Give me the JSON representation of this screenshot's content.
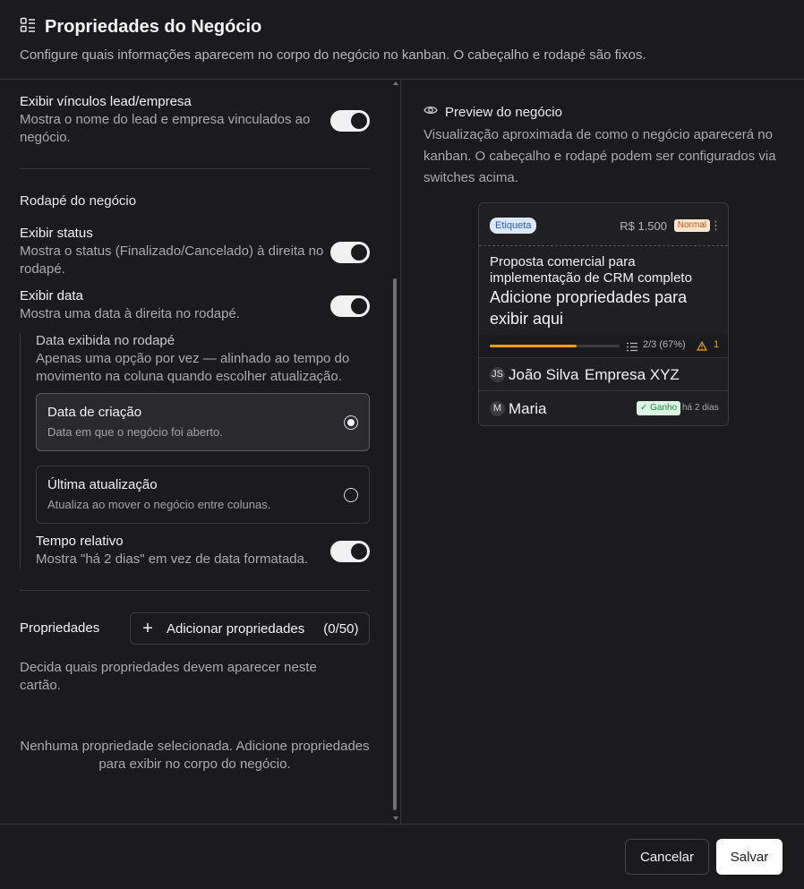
{
  "header": {
    "title": "Propriedades do Negócio",
    "subtitle": "Configure quais informações aparecem no corpo do negócio no kanban. O cabeçalho e rodapé são fixos."
  },
  "settings": {
    "links": {
      "title": "Exibir vínculos lead/empresa",
      "desc": "Mostra o nome do lead e empresa vinculados ao negócio.",
      "enabled": true
    },
    "footer_section_title": "Rodapé do negócio",
    "status": {
      "title": "Exibir status",
      "desc": "Mostra o status (Finalizado/Cancelado) à direita no rodapé.",
      "enabled": true
    },
    "date": {
      "title": "Exibir data",
      "desc": "Mostra uma data à direita no rodapé.",
      "enabled": true
    },
    "date_sub": {
      "title": "Data exibida no rodapé",
      "desc": "Apenas uma opção por vez — alinhado ao tempo do movimento na coluna quando escolher atualização.",
      "options": [
        {
          "title": "Data de criação",
          "desc": "Data em que o negócio foi aberto.",
          "selected": true
        },
        {
          "title": "Última atualização",
          "desc": "Atualiza ao mover o negócio entre colunas.",
          "selected": false
        }
      ]
    },
    "relative": {
      "title": "Tempo relativo",
      "desc": "Mostra \"há 2 dias\" em vez de data formatada.",
      "enabled": true
    },
    "properties": {
      "label": "Propriedades",
      "add_label": "Adicionar propriedades",
      "count": "(0/50)",
      "help": "Decida quais propriedades devem aparecer neste cartão.",
      "empty": "Nenhuma propriedade selecionada. Adicione propriedades para exibir no corpo do negócio."
    }
  },
  "preview": {
    "title": "Preview do negócio",
    "desc": "Visualização aproximada de como o negócio aparecerá no kanban. O cabeçalho e rodapé podem ser configurados via switches acima.",
    "card": {
      "tag": "Etiqueta",
      "price": "R$ 1.500",
      "priority": "Normal",
      "title": "Proposta comercial para implementação de CRM completo",
      "props_placeholder": "Adicione propriedades para exibir aqui",
      "progress_text": "2/3 (67%)",
      "progress_value": 0.67,
      "warning_count": "1",
      "lead_initials": "JS",
      "lead_name": "João Silva",
      "company": "Empresa XYZ",
      "owner_initial": "M",
      "owner_name": "Maria",
      "status": "✓ Ganho",
      "when": "há 2 dias"
    }
  },
  "footer": {
    "cancel": "Cancelar",
    "save": "Salvar"
  },
  "colors": {
    "background": "#1b1b1e",
    "accent_progress": "#f59e0b",
    "tag_bg": "#dbe7fb",
    "priority_bg": "#fde5cc",
    "won_bg": "#dcf6e3"
  }
}
